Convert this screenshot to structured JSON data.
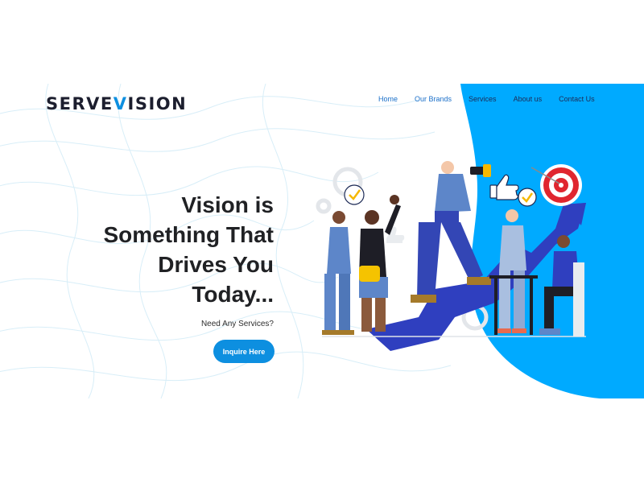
{
  "brand": {
    "logo_left": "SERVE",
    "logo_v": "V",
    "logo_right": "ISION"
  },
  "nav": {
    "items": [
      {
        "label": "Home"
      },
      {
        "label": "Our Brands"
      },
      {
        "label": "Services"
      },
      {
        "label": "About us"
      },
      {
        "label": "Contact Us"
      }
    ]
  },
  "hero": {
    "headline_lines": [
      "Vision is",
      "Something That",
      "Drives You",
      "Today..."
    ],
    "subtext": "Need Any Services?",
    "cta_label": "Inquire Here"
  },
  "colors": {
    "accent": "#0d8fe0",
    "blob": "#00aaff",
    "arrow": "#2f3fbf",
    "text": "#202124",
    "target_red": "#e0262f"
  },
  "icons": [
    "logo-v-icon",
    "checkmark-bubble-icon",
    "target-icon",
    "thumbs-up-icon",
    "binoculars-icon",
    "gear-icon"
  ]
}
